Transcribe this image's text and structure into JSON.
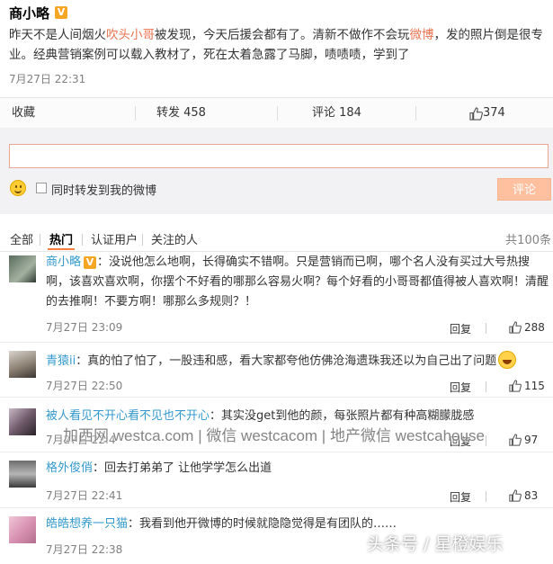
{
  "post": {
    "author": "商小略",
    "verified_badge": "V",
    "text_1": "昨天不是人间烟火",
    "text_link": "吹头小哥",
    "text_2": "被发现，今天后援会都有了。清新不做作不会玩",
    "text_link2": "微博",
    "text_3": "，发的照片倒是很专业。经典营销案例可以载入教材了，死在太着急露了马脚，啧啧啧，学到了",
    "time": "7月27日 22:31"
  },
  "actions": {
    "collect": "收藏",
    "repost": "转发 458",
    "comment": "评论 184",
    "like": "374"
  },
  "composer": {
    "input_value": "",
    "input_placeholder": "",
    "repost_checkbox_label": "同时转发到我的微博",
    "submit_label": "评论"
  },
  "tabs": {
    "items": [
      "全部",
      "热门",
      "认证用户",
      "关注的人"
    ],
    "active": "热门",
    "total": "共100条"
  },
  "comments": [
    {
      "user": "商小略",
      "verified": "V",
      "text": "：没说他怎么地啊，长得确实不错啊。只是营销而已啊，哪个名人没有买过大号热搜啊，该喜欢喜欢啊，你摆个不好看的哪那么容易火啊？每个好看的小哥哥都值得被人喜欢啊！清醒的去推啊！不要方啊！哪那么多规则？！",
      "time": "7月27日 23:09",
      "reply": "回复",
      "likes": "288"
    },
    {
      "user": "青猿ii",
      "text": "：真的怕了怕了，一股违和感，看大家都夸他仿佛沧海遗珠我还以为自己出了问题",
      "time": "7月27日 22:50",
      "reply": "回复",
      "likes": "115"
    },
    {
      "user": "被人看见不开心看不见也不开心",
      "text": "：其实没get到他的颜，每张照片都有种高糊朦胧感",
      "time": "7月27日 22:4",
      "reply": "回复",
      "likes": "97"
    },
    {
      "user": "格外俊俏",
      "text": "：回去打弟弟了 让他学学怎么出道",
      "time": "7月27日 22:41",
      "reply": "回复",
      "likes": "83"
    },
    {
      "user": "皓皓想养一只猫",
      "text": "：我看到他开微博的时候就隐隐觉得是有团队的……",
      "time": "7月27日 22:38",
      "reply": "回复",
      "likes": ""
    }
  ],
  "watermarks": {
    "site": "加西网 westca.com | 微信 westcacom | 地产微信 westcahouse",
    "source": "头条号 / 星橙娱乐"
  },
  "colors": {
    "link": "#eb7350",
    "username": "#3399cc",
    "submit": "#ffc09f",
    "tab_accent": "#fa7d3c"
  }
}
